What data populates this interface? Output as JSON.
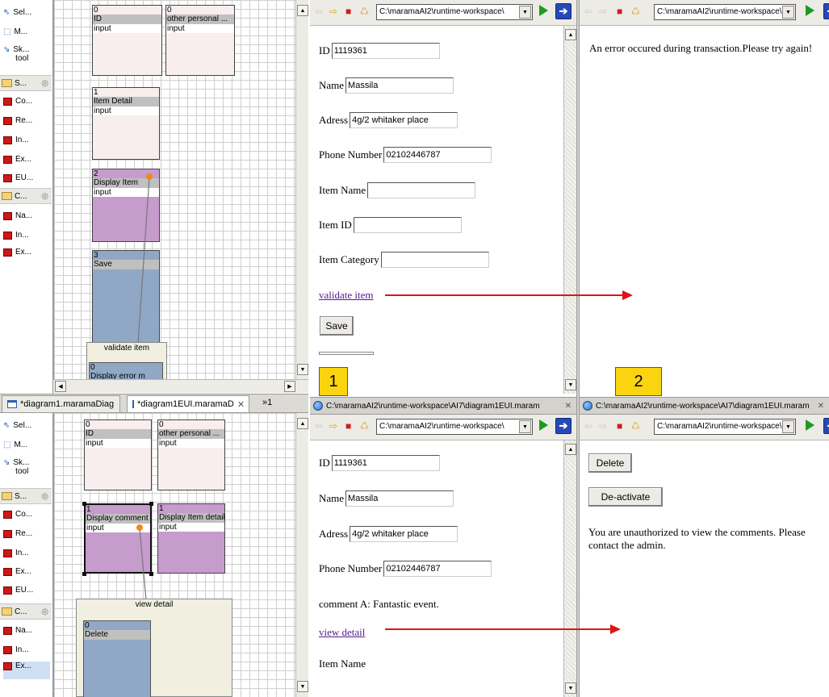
{
  "top_editor": {
    "palette": {
      "tools": [
        {
          "label": "Sel..."
        },
        {
          "label": "M..."
        },
        {
          "label": "Sk...\n tool"
        }
      ],
      "drawer1": "S...",
      "drawer1_items": [
        {
          "label": "Co..."
        },
        {
          "label": "Re..."
        },
        {
          "label": "In..."
        },
        {
          "label": "Ex..."
        },
        {
          "label": "EU..."
        }
      ],
      "drawer2": "C...",
      "drawer2_items": [
        {
          "label": "Na..."
        },
        {
          "label": "In..."
        },
        {
          "label": "Ex..."
        }
      ]
    },
    "widgets": [
      {
        "num": "0",
        "name": "ID",
        "type": "input"
      },
      {
        "num": "0",
        "name": "other personal ...",
        "type": "input"
      },
      {
        "num": "1",
        "name": "Item Detail",
        "type": "input"
      },
      {
        "num": "2",
        "name": "Display Item",
        "type": "input"
      },
      {
        "num": "3",
        "name": "Save",
        "type": ""
      }
    ],
    "event_box": {
      "label": "validate item",
      "inner_num": "0",
      "inner_name": "Display error m"
    }
  },
  "bottom_editor": {
    "tabs": [
      {
        "label": "*diagram1.maramaDiag"
      },
      {
        "label": "*diagram1EUI.maramaD"
      },
      {
        "label": "»1"
      }
    ],
    "palette": {
      "tools": [
        {
          "label": "Sel..."
        },
        {
          "label": "M..."
        },
        {
          "label": "Sk...\n tool"
        }
      ],
      "drawer1": "S...",
      "drawer1_items": [
        {
          "label": "Co..."
        },
        {
          "label": "Re..."
        },
        {
          "label": "In..."
        },
        {
          "label": "Ex..."
        },
        {
          "label": "EU..."
        }
      ],
      "drawer2": "C...",
      "drawer2_items": [
        {
          "label": "Na..."
        },
        {
          "label": "In..."
        },
        {
          "label": "Ex..."
        }
      ]
    },
    "widgets": [
      {
        "num": "0",
        "name": "ID",
        "type": "input"
      },
      {
        "num": "0",
        "name": "other personal ...",
        "type": "input"
      },
      {
        "num": "1",
        "name": "Display comment",
        "type": "input"
      },
      {
        "num": "1",
        "name": "Display Item detail",
        "type": "input"
      }
    ],
    "event_box": {
      "label": "view detail",
      "inner_num": "0",
      "inner_name": "Delete"
    }
  },
  "browser_url": "C:\\maramaAI2\\runtime-workspace\\",
  "browser_title": "C:\\maramaAI2\\runtime-workspace\\AI7\\diagram1EUI.maram",
  "browser1_top": {
    "fields": [
      {
        "label": "ID",
        "value": "1119361"
      },
      {
        "label": "Name",
        "value": "Massila"
      },
      {
        "label": "Adress",
        "value": "4g/2 whitaker place"
      },
      {
        "label": "Phone Number",
        "value": "02102446787"
      },
      {
        "label": "Item Name",
        "value": ""
      },
      {
        "label": "Item ID",
        "value": ""
      },
      {
        "label": "Item Category",
        "value": ""
      }
    ],
    "link": "validate item",
    "save_button": "Save"
  },
  "browser2_top": {
    "message": "An error occured during transaction.Please try again!"
  },
  "browser1_bottom": {
    "fields": [
      {
        "label": "ID",
        "value": "1119361"
      },
      {
        "label": "Name",
        "value": "Massila"
      },
      {
        "label": "Adress",
        "value": "4g/2 whitaker place"
      },
      {
        "label": "Phone Number",
        "value": "02102446787"
      }
    ],
    "comment": "comment A: Fantastic event.",
    "link": "view detail",
    "item_name_label": "Item Name"
  },
  "browser2_bottom": {
    "delete_button": "Delete",
    "deactivate_button": "De-activate",
    "message": "You are unauthorized to view the comments. Please contact the admin."
  },
  "callouts": {
    "one": "1",
    "two": "2"
  },
  "colors": {
    "arrow": "#e01414",
    "callout": "#fbd410",
    "violet_widget": "#c69ccc",
    "steel_widget": "#90a8c6"
  }
}
